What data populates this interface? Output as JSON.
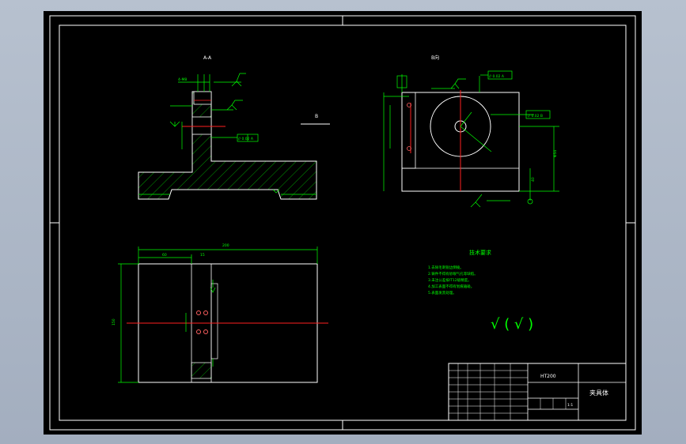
{
  "colors": {
    "background": "#000000",
    "frame": "#ffffff",
    "dimension": "#00ff00",
    "centerline": "#ff2020",
    "hatch": "#00d000",
    "feature": "#ff4040"
  },
  "views": {
    "section_label": "A-A",
    "top_view_label": "B向",
    "side_marker": "B"
  },
  "tech_requirements": {
    "title": "技术要求",
    "items": [
      "1.去除毛刺锐边倒棱。",
      "2.铸件不得有砂眼气孔等缺陷。",
      "3.未注公差按IT12级精度。",
      "4.加工表面不得有划痕磕碰。",
      "5.表面发黑处理。"
    ],
    "roughness_symbol": "√ ( √ )"
  },
  "title_block": {
    "material": "HT200",
    "part_name": "夹具体",
    "sheet": "1:1"
  },
  "dimensions": {
    "overall_width": "200",
    "overall_height": "150",
    "offset_left": "60",
    "gap": "15",
    "height_right": "Φ54",
    "height_right2": "40"
  }
}
